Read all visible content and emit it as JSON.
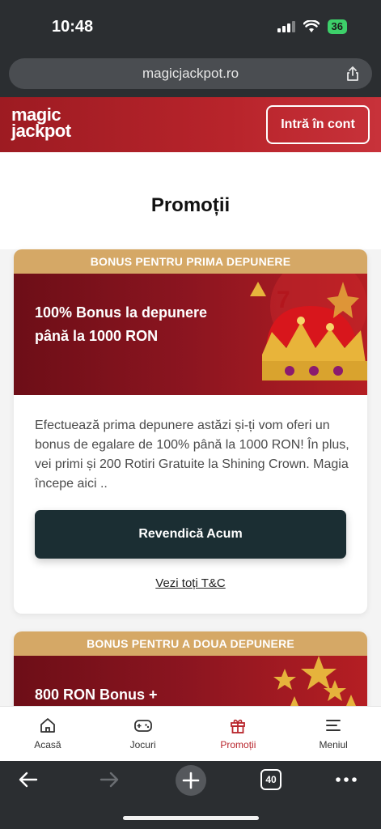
{
  "status": {
    "time": "10:48",
    "battery": "36"
  },
  "browser": {
    "url": "magicjackpot.ro",
    "tabs_count": "40"
  },
  "header": {
    "logo_line1": "magic",
    "logo_line2": "jackpot",
    "login_label": "Intră în cont"
  },
  "page": {
    "title": "Promoții"
  },
  "promos": [
    {
      "label": "BONUS PENTRU PRIMA DEPUNERE",
      "title": "100% Bonus la depunere până la 1000 RON",
      "description": "Efectuează prima depunere astăzi și-ți vom oferi un bonus de egalare de 100% până la 1000 RON! În plus, vei primi și 200 Rotiri Gratuite la Shining Crown. Magia începe aici ..",
      "cta": "Revendică Acum",
      "tc": "Vezi toți T&C"
    },
    {
      "label": "BONUS PENTRU A DOUA DEPUNERE",
      "title": "800 RON Bonus +"
    }
  ],
  "nav": [
    {
      "label": "Acasă",
      "icon": "home-icon"
    },
    {
      "label": "Jocuri",
      "icon": "gamepad-icon"
    },
    {
      "label": "Promoții",
      "icon": "gift-icon",
      "active": true
    },
    {
      "label": "Meniul",
      "icon": "menu-icon"
    }
  ],
  "colors": {
    "brand_red": "#b8242b",
    "gold": "#d5a866",
    "cta_dark": "#1b2e33"
  }
}
